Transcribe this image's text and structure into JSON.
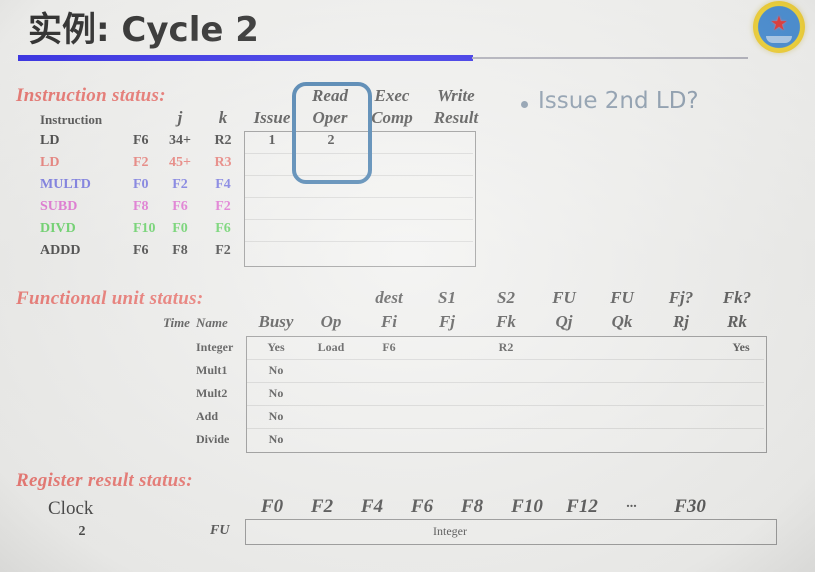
{
  "slide": {
    "title": "实例: Cycle 2",
    "logo_icon": "university-emblem-icon"
  },
  "bullet": {
    "text": "Issue 2nd LD?"
  },
  "instruction_status": {
    "heading": "Instruction status:",
    "upper_headers": [
      "Read",
      "Exec",
      "Write"
    ],
    "lower_headers": [
      "Instruction",
      "j",
      "k",
      "Issue",
      "Oper",
      "Comp",
      "Result"
    ],
    "rows": [
      {
        "op": "LD",
        "dest": "F6",
        "j": "34+",
        "k": "R2",
        "issue": "1",
        "read_oper": "2",
        "exec_comp": "",
        "write_result": "",
        "color": "#2b2b2b"
      },
      {
        "op": "LD",
        "dest": "F2",
        "j": "45+",
        "k": "R3",
        "issue": "",
        "read_oper": "",
        "exec_comp": "",
        "write_result": "",
        "color": "#e8706a"
      },
      {
        "op": "MULTD",
        "dest": "F0",
        "j": "F2",
        "k": "F4",
        "issue": "",
        "read_oper": "",
        "exec_comp": "",
        "write_result": "",
        "color": "#6a6ae0"
      },
      {
        "op": "SUBD",
        "dest": "F8",
        "j": "F6",
        "k": "F2",
        "issue": "",
        "read_oper": "",
        "exec_comp": "",
        "write_result": "",
        "color": "#df63cf"
      },
      {
        "op": "DIVD",
        "dest": "F10",
        "j": "F0",
        "k": "F6",
        "issue": "",
        "read_oper": "",
        "exec_comp": "",
        "write_result": "",
        "color": "#56cf56"
      },
      {
        "op": "ADDD",
        "dest": "F6",
        "j": "F8",
        "k": "F2",
        "issue": "",
        "read_oper": "",
        "exec_comp": "",
        "write_result": "",
        "color": "#2b2b2b"
      }
    ],
    "highlight_column": "Read Oper",
    "highlight_color": "#2f6ea5"
  },
  "functional_unit_status": {
    "heading": "Functional unit status:",
    "upper_headers": [
      "dest",
      "S1",
      "S2",
      "FU",
      "FU",
      "Fj?",
      "Fk?"
    ],
    "lower_headers": [
      "Time",
      "Name",
      "Busy",
      "Op",
      "Fi",
      "Fj",
      "Fk",
      "Qj",
      "Qk",
      "Rj",
      "Rk"
    ],
    "rows": [
      {
        "time": "",
        "name": "Integer",
        "busy": "Yes",
        "op": "Load",
        "fi": "F6",
        "fj": "",
        "fk": "R2",
        "qj": "",
        "qk": "",
        "rj": "",
        "rk": "Yes"
      },
      {
        "time": "",
        "name": "Mult1",
        "busy": "No",
        "op": "",
        "fi": "",
        "fj": "",
        "fk": "",
        "qj": "",
        "qk": "",
        "rj": "",
        "rk": ""
      },
      {
        "time": "",
        "name": "Mult2",
        "busy": "No",
        "op": "",
        "fi": "",
        "fj": "",
        "fk": "",
        "qj": "",
        "qk": "",
        "rj": "",
        "rk": ""
      },
      {
        "time": "",
        "name": "Add",
        "busy": "No",
        "op": "",
        "fi": "",
        "fj": "",
        "fk": "",
        "qj": "",
        "qk": "",
        "rj": "",
        "rk": ""
      },
      {
        "time": "",
        "name": "Divide",
        "busy": "No",
        "op": "",
        "fi": "",
        "fj": "",
        "fk": "",
        "qj": "",
        "qk": "",
        "rj": "",
        "rk": ""
      }
    ]
  },
  "register_result_status": {
    "heading": "Register result status:",
    "clock_label": "Clock",
    "clock_value": "2",
    "fu_label": "FU",
    "registers": [
      "F0",
      "F2",
      "F4",
      "F6",
      "F8",
      "F10",
      "F12",
      "...",
      "F30"
    ],
    "fu_entry": "Integer"
  }
}
